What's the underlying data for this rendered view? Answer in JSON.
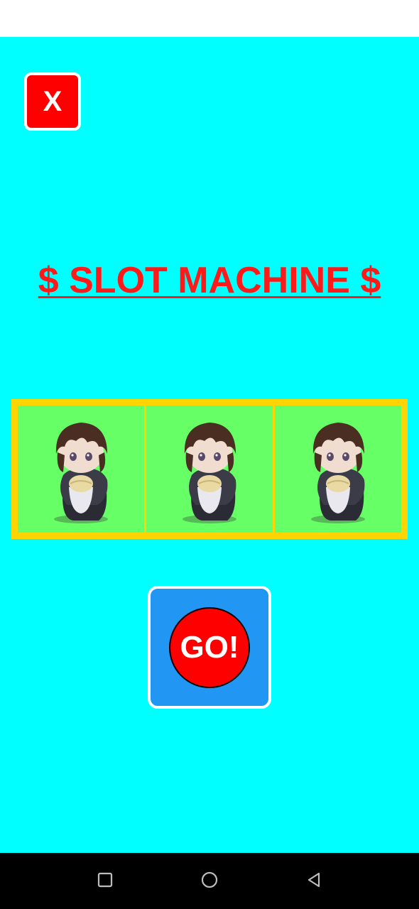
{
  "close_button": {
    "label": "X"
  },
  "title": "$ SLOT MACHINE $",
  "reels": [
    {
      "symbol": "chibi-character-icon"
    },
    {
      "symbol": "chibi-character-icon"
    },
    {
      "symbol": "chibi-character-icon"
    }
  ],
  "go_button": {
    "label": "GO!"
  },
  "nav": {
    "recents": "square-icon",
    "home": "circle-icon",
    "back": "triangle-back-icon"
  },
  "colors": {
    "background": "#00ffff",
    "close_button": "#ff0000",
    "title": "#ff1a1a",
    "reel_frame": "#ffd400",
    "reel_bg": "#66ff66",
    "go_button": "#2196f3",
    "go_circle": "#ff0000"
  }
}
